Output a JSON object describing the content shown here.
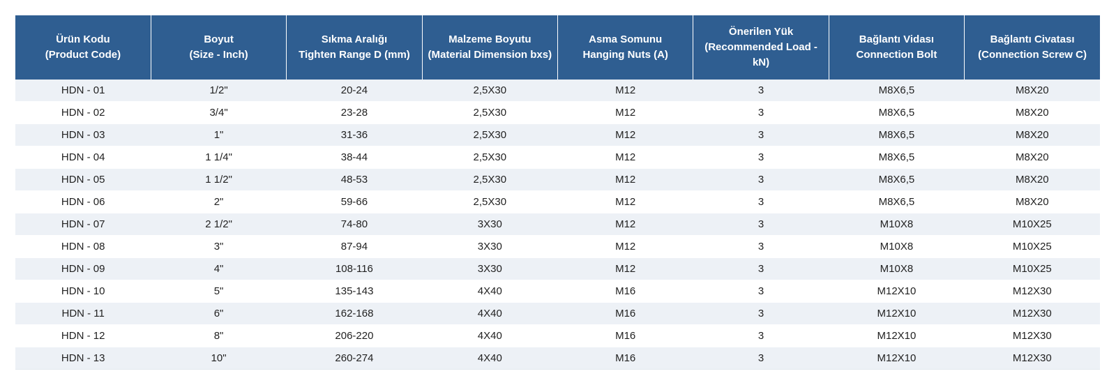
{
  "table": {
    "headers": [
      [
        "Ürün Kodu",
        "(Product Code)"
      ],
      [
        "Boyut",
        "(Size - Inch)"
      ],
      [
        "Sıkma Aralığı",
        "Tighten Range D (mm)"
      ],
      [
        "Malzeme Boyutu",
        "(Material Dimension bxs)"
      ],
      [
        "Asma Somunu",
        "Hanging Nuts (A)"
      ],
      [
        "Önerilen Yük",
        "(Recommended Load -",
        "kN)"
      ],
      [
        "Bağlantı Vidası",
        "Connection Bolt"
      ],
      [
        "Bağlantı Civatası",
        "(Connection Screw C)"
      ]
    ],
    "rows": [
      [
        "HDN - 01",
        "1/2\"",
        "20-24",
        "2,5X30",
        "M12",
        "3",
        "M8X6,5",
        "M8X20"
      ],
      [
        "HDN - 02",
        "3/4\"",
        "23-28",
        "2,5X30",
        "M12",
        "3",
        "M8X6,5",
        "M8X20"
      ],
      [
        "HDN - 03",
        "1\"",
        "31-36",
        "2,5X30",
        "M12",
        "3",
        "M8X6,5",
        "M8X20"
      ],
      [
        "HDN - 04",
        "1 1/4\"",
        "38-44",
        "2,5X30",
        "M12",
        "3",
        "M8X6,5",
        "M8X20"
      ],
      [
        "HDN - 05",
        "1 1/2\"",
        "48-53",
        "2,5X30",
        "M12",
        "3",
        "M8X6,5",
        "M8X20"
      ],
      [
        "HDN - 06",
        "2\"",
        "59-66",
        "2,5X30",
        "M12",
        "3",
        "M8X6,5",
        "M8X20"
      ],
      [
        "HDN - 07",
        "2 1/2\"",
        "74-80",
        "3X30",
        "M12",
        "3",
        "M10X8",
        "M10X25"
      ],
      [
        "HDN - 08",
        "3\"",
        "87-94",
        "3X30",
        "M12",
        "3",
        "M10X8",
        "M10X25"
      ],
      [
        "HDN - 09",
        "4\"",
        "108-116",
        "3X30",
        "M12",
        "3",
        "M10X8",
        "M10X25"
      ],
      [
        "HDN - 10",
        "5\"",
        "135-143",
        "4X40",
        "M16",
        "3",
        "M12X10",
        "M12X30"
      ],
      [
        "HDN - 11",
        "6\"",
        "162-168",
        "4X40",
        "M16",
        "3",
        "M12X10",
        "M12X30"
      ],
      [
        "HDN - 12",
        "8\"",
        "206-220",
        "4X40",
        "M16",
        "3",
        "M12X10",
        "M12X30"
      ],
      [
        "HDN - 13",
        "10\"",
        "260-274",
        "4X40",
        "M16",
        "3",
        "M12X10",
        "M12X30"
      ]
    ]
  },
  "colors": {
    "header_bg": "#2f5e91",
    "header_text": "#ffffff",
    "row_stripe": "#edf1f6",
    "row_plain": "#ffffff"
  }
}
